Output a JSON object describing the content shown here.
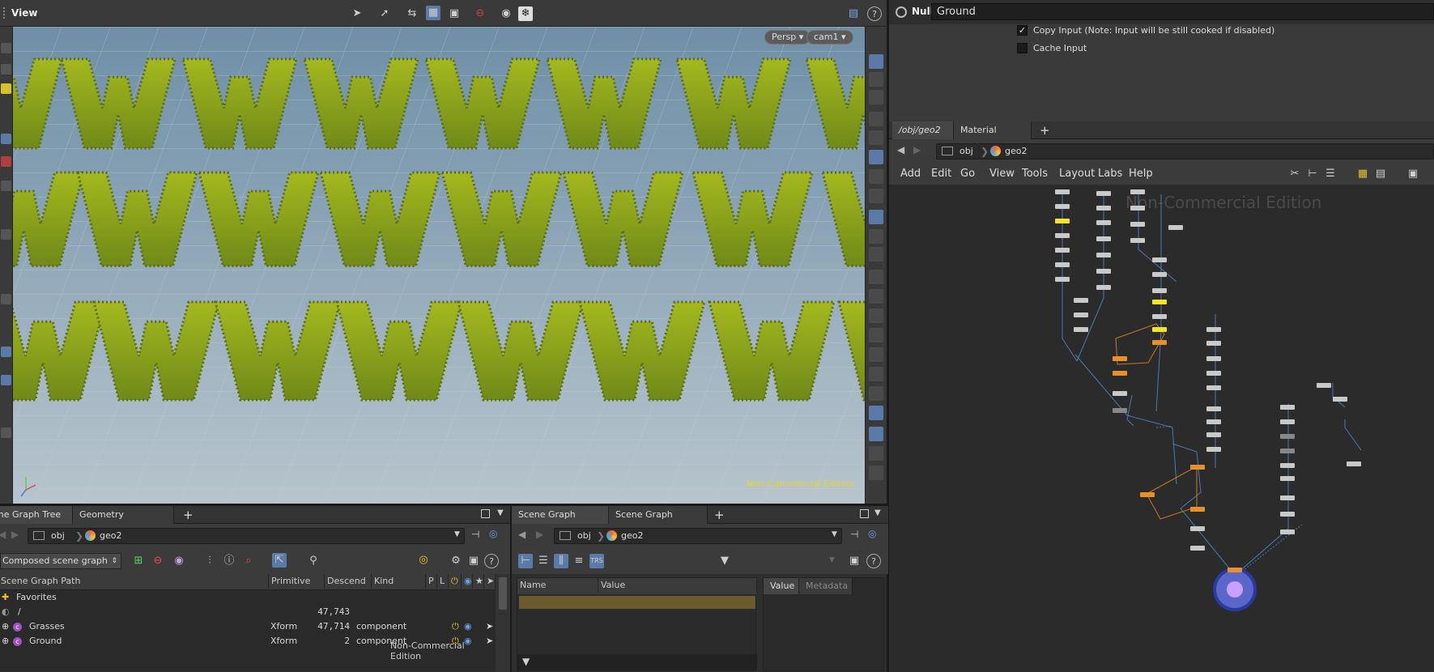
{
  "viewport": {
    "title": "View",
    "camera_persp": "Persp",
    "camera_name": "cam1",
    "watermark": "Non-Commercial Edition"
  },
  "scene_graph_tree": {
    "tabs": [
      "Scene Graph Tree",
      "Geometry Spreadsheet"
    ],
    "path_root": "obj",
    "path_node": "geo2",
    "mode": "Composed scene graph",
    "columns": [
      "Scene Graph Path",
      "Primitive",
      "Descend",
      "Kind",
      "P",
      "L"
    ],
    "rows": [
      {
        "path": "Favorites",
        "primitive": "",
        "descend": "",
        "kind": ""
      },
      {
        "path": "/",
        "primitive": "",
        "descend": "47,743",
        "kind": ""
      },
      {
        "path": "Grasses",
        "primitive": "Xform",
        "descend": "47,714",
        "kind": "component"
      },
      {
        "path": "Ground",
        "primitive": "Xform",
        "descend": "2",
        "kind": "component"
      }
    ],
    "watermark": "Non-Commercial Edition"
  },
  "scene_graph_details": {
    "tabs": [
      "Scene Graph Details",
      "Scene Graph Layers"
    ],
    "path_root": "obj",
    "path_node": "geo2",
    "col_name": "Name",
    "col_value": "Value",
    "side_tabs": [
      "Value",
      "Metadata"
    ]
  },
  "params": {
    "node_type": "Null",
    "node_name": "Ground",
    "copy_input_label": "Copy Input (Note: Input will be still cooked if disabled)",
    "cache_input_label": "Cache Input",
    "copy_input_checked": true,
    "cache_input_checked": false
  },
  "network": {
    "tabs": [
      "/obj/geo2",
      "Material Palette"
    ],
    "path_root": "obj",
    "path_node": "geo2",
    "menu": [
      "Add",
      "Edit",
      "Go",
      "View",
      "Tools",
      "Layout",
      "Labs",
      "Help"
    ],
    "watermark": "Non-Commercial Edition"
  },
  "colors": {
    "accent_blue": "#5a7aa8",
    "node_yellow": "#f5e22a",
    "node_orange": "#e8902a",
    "grass": "#8aa31e",
    "watermark_yellow": "#e6d32a"
  }
}
